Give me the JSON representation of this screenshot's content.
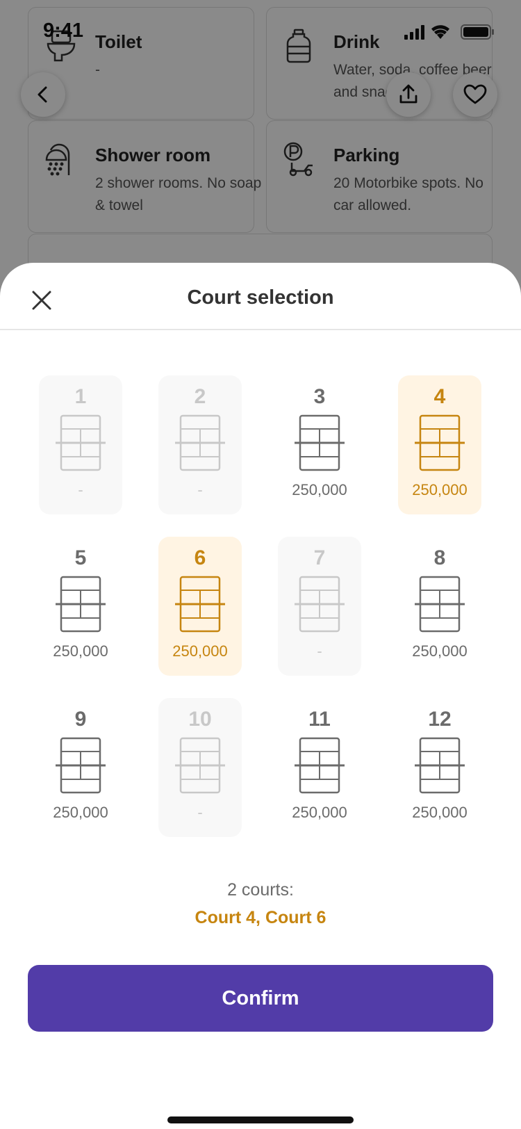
{
  "status_bar": {
    "time": "9:41"
  },
  "background": {
    "amenities": [
      {
        "title": "Toilet",
        "desc": "-",
        "icon": "toilet-icon"
      },
      {
        "title": "Drink",
        "desc": "Water, soda, coffee beer and snacks",
        "icon": "bottle-icon"
      },
      {
        "title": "Shower room",
        "desc": "2 shower rooms. No soap & towel",
        "icon": "shower-icon"
      },
      {
        "title": "Parking",
        "desc": "20 Motorbike spots. No car allowed.",
        "icon": "parking-icon"
      }
    ]
  },
  "sheet": {
    "title": "Court selection",
    "courts": [
      {
        "number": "1",
        "price": "-",
        "state": "disabled"
      },
      {
        "number": "2",
        "price": "-",
        "state": "disabled"
      },
      {
        "number": "3",
        "price": "250,000",
        "state": "available"
      },
      {
        "number": "4",
        "price": "250,000",
        "state": "selected"
      },
      {
        "number": "5",
        "price": "250,000",
        "state": "available"
      },
      {
        "number": "6",
        "price": "250,000",
        "state": "selected"
      },
      {
        "number": "7",
        "price": "-",
        "state": "disabled"
      },
      {
        "number": "8",
        "price": "250,000",
        "state": "available"
      },
      {
        "number": "9",
        "price": "250,000",
        "state": "available"
      },
      {
        "number": "10",
        "price": "-",
        "state": "disabled"
      },
      {
        "number": "11",
        "price": "250,000",
        "state": "available"
      },
      {
        "number": "12",
        "price": "250,000",
        "state": "available"
      }
    ],
    "summary_count": "2 courts:",
    "summary_courts": "Court 4, Court 6",
    "confirm_label": "Confirm"
  },
  "colors": {
    "accent": "#523ca8",
    "selected": "#c68510",
    "selected_bg": "#fff4e3",
    "available": "#6b6b6b",
    "disabled": "#c8c8c8"
  }
}
